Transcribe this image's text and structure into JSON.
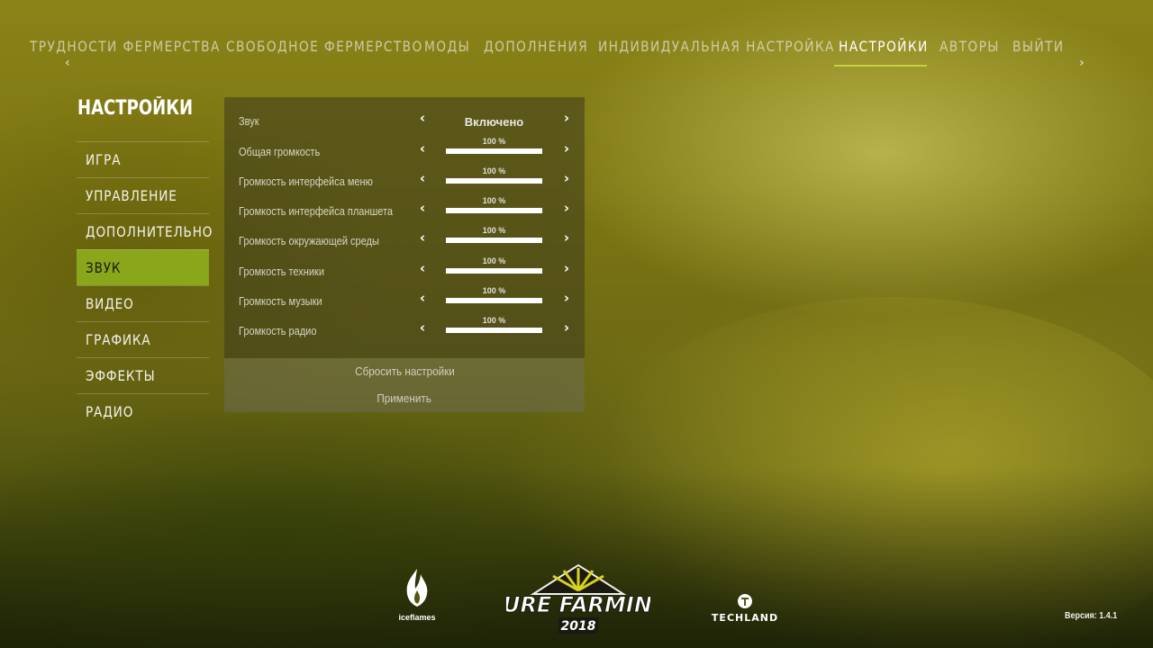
{
  "topnav": {
    "items": [
      {
        "label": "ТРУДНОСТИ ФЕРМЕРСТВА"
      },
      {
        "label": "СВОБОДНОЕ ФЕРМЕРСТВО"
      },
      {
        "label": "МОДЫ"
      },
      {
        "label": "ДОПОЛНЕНИЯ"
      },
      {
        "label": "ИНДИВИДУАЛЬНАЯ НАСТРОЙКА"
      },
      {
        "label": "НАСТРОЙКИ"
      },
      {
        "label": "АВТОРЫ"
      },
      {
        "label": "ВЫЙТИ"
      }
    ],
    "active_label": "НАСТРОЙКИ",
    "accent_color": "#c6d23a"
  },
  "sidebar": {
    "title": "НАСТРОЙКИ",
    "items": [
      {
        "label": "ИГРА"
      },
      {
        "label": "УПРАВЛЕНИЕ"
      },
      {
        "label": "ДОПОЛНИТЕЛЬНО"
      },
      {
        "label": "ЗВУК"
      },
      {
        "label": "ВИДЕО"
      },
      {
        "label": "ГРАФИКА"
      },
      {
        "label": "ЭФФЕКТЫ"
      },
      {
        "label": "РАДИО"
      }
    ],
    "active_label": "ЗВУК",
    "active_color": "#8aa61a"
  },
  "sound": {
    "toggle": {
      "label": "Звук",
      "value": "Включено"
    },
    "sliders": [
      {
        "label": "Общая громкость",
        "percent_text": "100 %",
        "level": 1.0
      },
      {
        "label": "Громкость интерфейса меню",
        "percent_text": "100 %",
        "level": 1.0
      },
      {
        "label": "Громкость интерфейса планшета",
        "percent_text": "100 %",
        "level": 1.0
      },
      {
        "label": "Громкость окружающей среды",
        "percent_text": "100 %",
        "level": 1.0
      },
      {
        "label": "Громкость техники",
        "percent_text": "100 %",
        "level": 1.0
      },
      {
        "label": "Громкость музыки",
        "percent_text": "100 %",
        "level": 1.0
      },
      {
        "label": "Громкость радио",
        "percent_text": "100 %",
        "level": 1.0
      }
    ],
    "prev_icon": "chevron-left-icon",
    "next_icon": "chevron-right-icon"
  },
  "actions": {
    "reset_label": "Сбросить настройки",
    "apply_label": "Применить"
  },
  "logos": {
    "iceflames": "iceflames",
    "purefarming_title": "PURE FARMING",
    "purefarming_year": "2018",
    "techland": "TECHLAND"
  },
  "footer": {
    "version": "Версия: 1.4.1"
  }
}
